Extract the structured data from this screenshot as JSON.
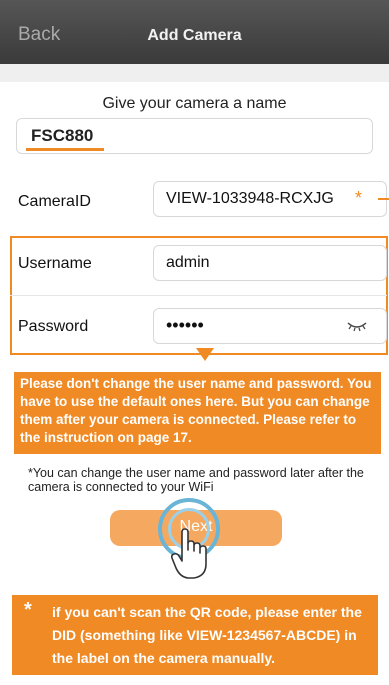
{
  "nav": {
    "back_label": "Back",
    "title": "Add Camera"
  },
  "form": {
    "name_prompt": "Give your camera a name",
    "camera_name": "FSC880",
    "camera_id_label": "CameraID",
    "camera_id_value": "VIEW-1033948-RCXJG",
    "required_marker": "*",
    "username_label": "Username",
    "username_value": "admin",
    "password_label": "Password",
    "password_value": "••••••",
    "next_label": "Next"
  },
  "callout": "Please don't change the user name and password. You have to use the default ones here. But you can change them after your camera is connected. Please refer to the instruction on page 17.",
  "footnote": "*You can change the user name and password later after the camera is connected to your WiFi",
  "bottom_tip": {
    "marker": "*",
    "text": "if you can't scan the QR code, please enter the DID (something like VIEW-1234567-ABCDE) in the label on the camera manually."
  },
  "colors": {
    "accent": "#f08a24",
    "button": "#f5a960",
    "ring": "#6ab4d6",
    "nav": "#4a4a4a"
  },
  "icons": {
    "password_toggle": "eye-closed-icon",
    "tap": "hand-pointer-icon"
  }
}
